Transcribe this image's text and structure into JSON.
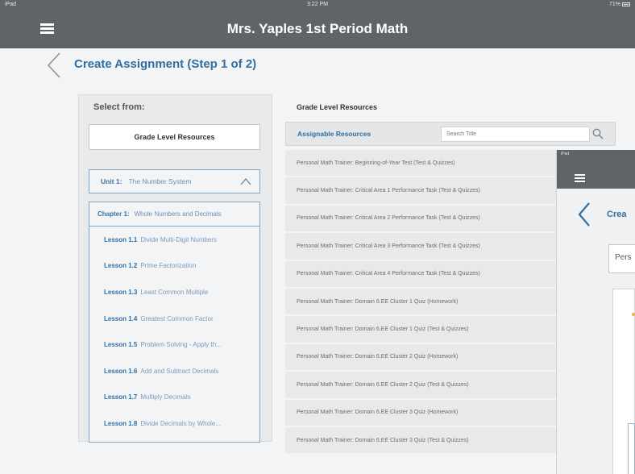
{
  "status_bar": {
    "carrier": "iPad",
    "time": "3:22 PM",
    "battery": "71%"
  },
  "header": {
    "app_title": "Mrs. Yaples 1st Period Math",
    "page_title": "Create Assignment (Step 1 of 2)"
  },
  "left_panel": {
    "select_from_label": "Select from:",
    "source_button": "Grade Level Resources",
    "unit": {
      "label": "Unit 1:",
      "name": "The Number System"
    },
    "chapter": {
      "label": "Chapter 1:",
      "name": "Whole Numbers and Decimals"
    },
    "lessons": [
      {
        "label": "Lesson 1.1",
        "name": "Divide Multi-Digit Numbers"
      },
      {
        "label": "Lesson 1.2",
        "name": "Prime Factorization"
      },
      {
        "label": "Lesson 1.3",
        "name": "Least Common Multiple"
      },
      {
        "label": "Lesson 1.4",
        "name": "Greatest Common Factor"
      },
      {
        "label": "Lesson 1.5",
        "name": "Problem Solving - Apply th..."
      },
      {
        "label": "Lesson 1.6",
        "name": "Add and Subtract Decimals"
      },
      {
        "label": "Lesson 1.7",
        "name": "Multiply Decimals"
      },
      {
        "label": "Lesson 1.8",
        "name": "Divide Decimals by Whole..."
      }
    ]
  },
  "middle_panel": {
    "title": "Grade Level Resources",
    "assignable_label": "Assignable Resources",
    "search_placeholder": "Search Title",
    "resources": [
      "Personal Math Trainer: Beginning-of-Year Test (Test & Quizzes)",
      "Personal Math Trainer: Critical Area 1 Performance Task (Test & Quizzes)",
      "Personal Math Trainer: Critical Area 2 Performance Task (Test & Quizzes)",
      "Personal Math Trainer: Critical Area 3 Performance Task (Test & Quizzes)",
      "Personal Math Trainer: Critical Area 4 Performance Task (Test & Quizzes)",
      "Personal Math Trainer: Domain 6.EE Cluster 1 Quiz (Homework)",
      "Personal Math Trainer: Domain 6.EE Cluster 1 Quiz (Test & Quizzes)",
      "Personal Math Trainer: Domain 6.EE Cluster 2 Quiz (Homework)",
      "Personal Math Trainer: Domain 6.EE Cluster 2 Quiz (Test & Quizzes)",
      "Personal Math Trainer: Domain 6.EE Cluster 3 Quiz (Homework)",
      "Personal Math Trainer: Domain 6.EE Cluster 3 Quiz (Test & Quizzes)"
    ]
  },
  "overlay": {
    "status": "iPad",
    "title": "Crea",
    "field_text": "Pers"
  }
}
